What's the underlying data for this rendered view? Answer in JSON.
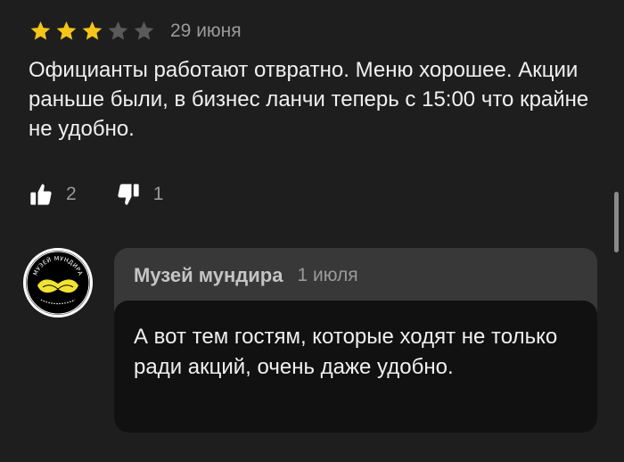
{
  "review": {
    "rating": 3,
    "rating_max": 5,
    "date": "29 июня",
    "text": "Официанты работают отвратно. Меню хорошее. Акции раньше были, в бизнес ланчи теперь с 15:00 что крайне не удобно.",
    "likes": "2",
    "dislikes": "1"
  },
  "reply": {
    "author": "Музей мундира",
    "date": "1 июля",
    "text": "А вот тем гостям, которые ходят не только ради акций, очень даже удобно.",
    "avatar_logo_text": "МУЗЕЙ МУНДИРА"
  },
  "colors": {
    "background": "#1e1e1e",
    "star_filled": "#f5c518",
    "star_empty": "#5a5a5a",
    "reply_header_bg": "#383838",
    "reply_body_bg": "#111111",
    "muted_text": "#9a9a9a"
  },
  "icons": {
    "like": "thumbs-up-icon",
    "dislike": "thumbs-down-icon",
    "star": "star-icon"
  }
}
